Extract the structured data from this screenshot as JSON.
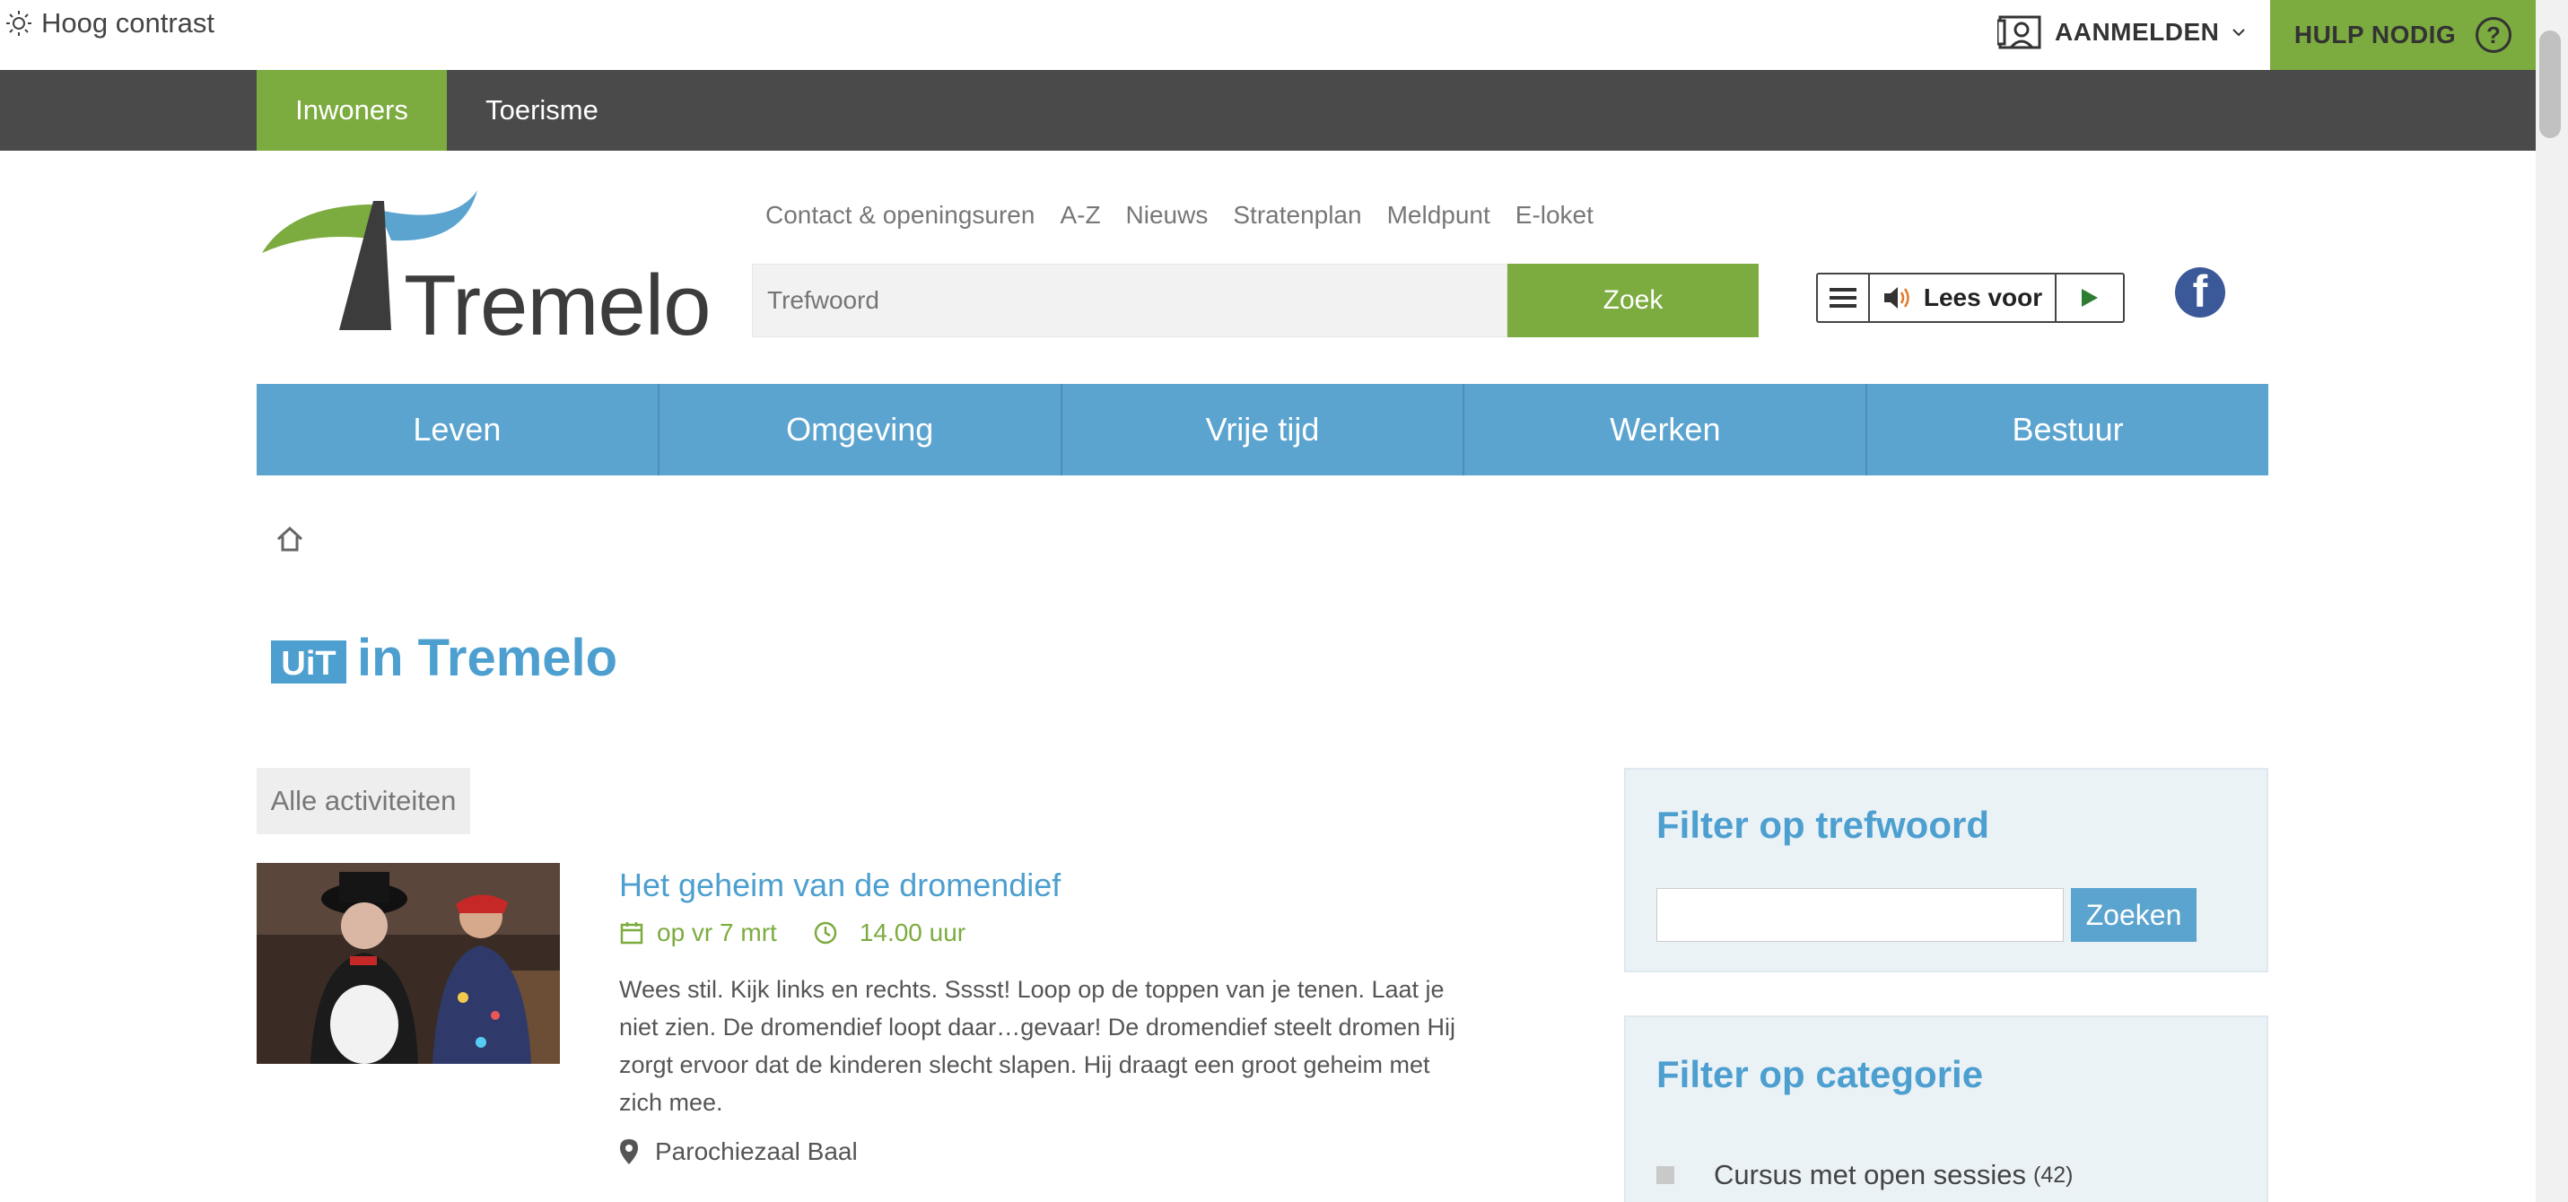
{
  "utility": {
    "contrast_label": "Hoog contrast",
    "login_label": "AANMELDEN",
    "help_label": "HULP NODIG",
    "help_icon": "?"
  },
  "tabs": [
    {
      "label": "Inwoners",
      "active": true
    },
    {
      "label": "Toerisme",
      "active": false
    }
  ],
  "brand": {
    "logo_text": "Tremelo",
    "colors": {
      "green": "#7cab3f",
      "blue": "#5ba4cf",
      "dark": "#4a4a4a"
    }
  },
  "quicklinks": [
    "Contact & openingsuren",
    "A-Z",
    "Nieuws",
    "Stratenplan",
    "Meldpunt",
    "E-loket"
  ],
  "search": {
    "placeholder": "Trefwoord",
    "button": "Zoek"
  },
  "reader": {
    "label": "Lees voor"
  },
  "main_nav": [
    "Leven",
    "Omgeving",
    "Vrije tijd",
    "Werken",
    "Bestuur"
  ],
  "page": {
    "uit_logo_text": "UiT",
    "title": "in Tremelo",
    "all_activities": "Alle activiteiten"
  },
  "event": {
    "title": "Het geheim van de dromendief",
    "date": "op vr 7 mrt",
    "time": "14.00 uur",
    "description": "Wees stil. Kijk links en rechts. Sssst! Loop op de toppen van je tenen. Laat je niet zien. De dromendief loopt daar…gevaar! De dromendief steelt dromen Hij zorgt ervoor dat de kinderen slecht slapen. Hij draagt een groot geheim met zich mee.",
    "location": "Parochiezaal Baal"
  },
  "sidebar": {
    "keyword_title": "Filter op trefwoord",
    "keyword_button": "Zoeken",
    "category_title": "Filter op categorie",
    "categories": [
      {
        "label": "Cursus met open sessies",
        "count": "(42)"
      }
    ]
  }
}
